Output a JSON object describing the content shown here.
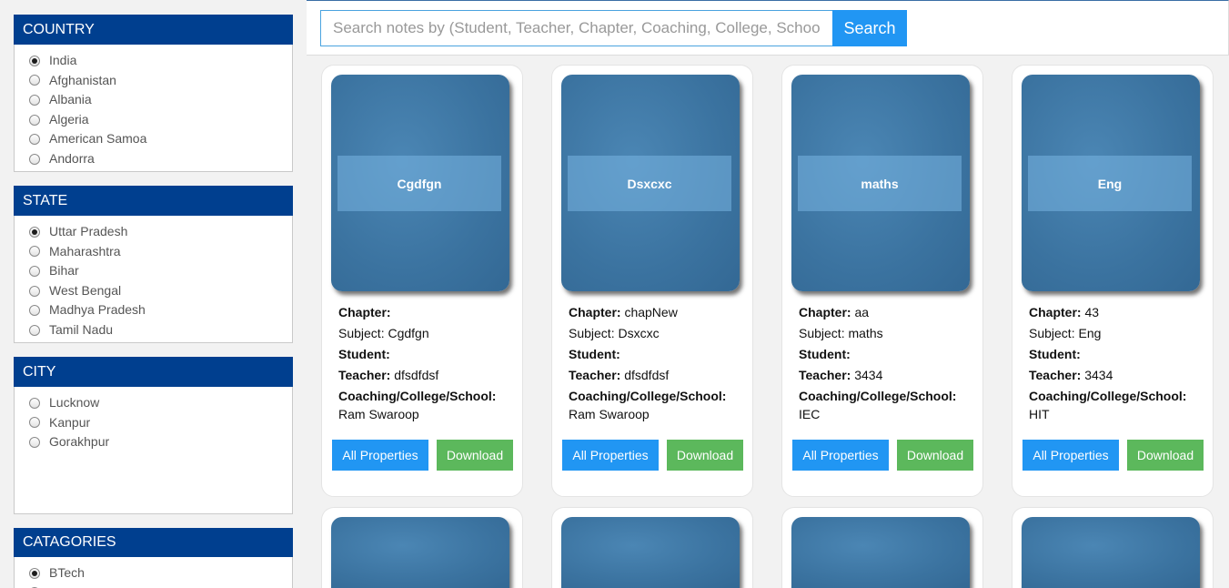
{
  "filters": {
    "country": {
      "title": "COUNTRY",
      "options": [
        "India",
        "Afghanistan",
        "Albania",
        "Algeria",
        "American Samoa",
        "Andorra"
      ],
      "selected": "India"
    },
    "state": {
      "title": "STATE",
      "options": [
        "Uttar Pradesh",
        "Maharashtra",
        "Bihar",
        "West Bengal",
        "Madhya Pradesh",
        "Tamil Nadu"
      ],
      "selected": "Uttar Pradesh"
    },
    "city": {
      "title": "CITY",
      "options": [
        "Lucknow",
        "Kanpur",
        "Gorakhpur"
      ],
      "selected": ""
    },
    "categories": {
      "title": "CATAGORIES",
      "options": [
        "BTech"
      ],
      "selected": "BTech"
    }
  },
  "search": {
    "placeholder": "Search notes by (Student, Teacher, Chapter, Coaching, College, School)",
    "button_label": "Search"
  },
  "labels": {
    "chapter": "Chapter:",
    "subject": "Subject:",
    "student": "Student:",
    "teacher": "Teacher:",
    "coaching": "Coaching/College/School:",
    "all_properties": "All Properties",
    "download": "Download"
  },
  "cards": [
    {
      "cover_title": "Cgdfgn",
      "chapter": "",
      "subject": "Cgdfgn",
      "student": "",
      "teacher": "dfsdfdsf",
      "coaching": "Ram Swaroop"
    },
    {
      "cover_title": "Dsxcxc",
      "chapter": "chapNew",
      "subject": "Dsxcxc",
      "student": "",
      "teacher": "dfsdfdsf",
      "coaching": "Ram Swaroop"
    },
    {
      "cover_title": "maths",
      "chapter": "aa",
      "subject": "maths",
      "student": "",
      "teacher": "3434",
      "coaching": "IEC"
    },
    {
      "cover_title": "Eng",
      "chapter": "43",
      "subject": "Eng",
      "student": "",
      "teacher": "3434",
      "coaching": "HIT"
    }
  ],
  "colors": {
    "header_blue": "#003f8f",
    "primary": "#2196f3",
    "success": "#5cb85c",
    "cover": "#3b73a0"
  }
}
